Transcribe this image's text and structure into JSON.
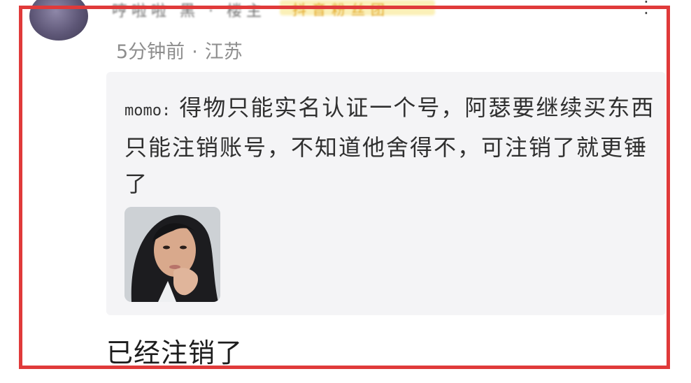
{
  "comment": {
    "username": "哼啦啦 黑 · 楼主",
    "badge": "抖音粉丝团",
    "time": "5分钟前",
    "location": "江苏",
    "quote": {
      "author": "momo:",
      "text": "得物只能实名认证一个号，阿瑟要继续买东西只能注销账号，不知道他舍得不，可注销了就更锤了"
    },
    "reply": "已经注销了"
  },
  "icons": {
    "more": "more-icon",
    "avatar": "avatar"
  },
  "colors": {
    "frame": "#e03a3a",
    "quote_background": "#f4f4f6",
    "meta_text": "#8e8e8e"
  }
}
